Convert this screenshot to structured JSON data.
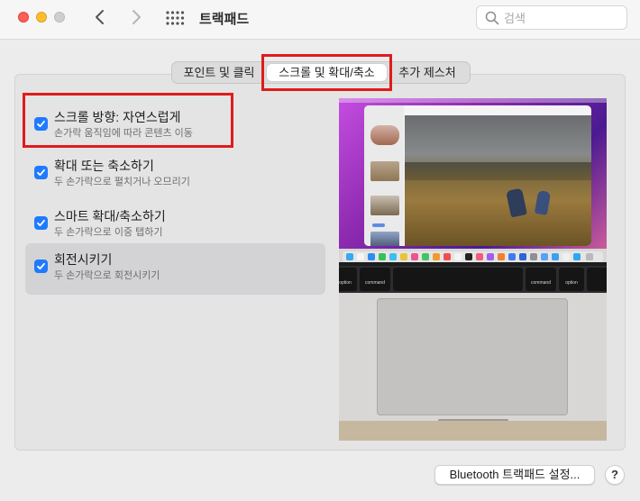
{
  "window": {
    "title": "트랙패드",
    "search_placeholder": "검색"
  },
  "tabs": [
    {
      "label": "포인트 및 클릭",
      "selected": false
    },
    {
      "label": "스크롤 및 확대/축소",
      "selected": true
    },
    {
      "label": "추가 제스처",
      "selected": false
    }
  ],
  "options": [
    {
      "title": "스크롤 방향: 자연스럽게",
      "subtitle": "손가락 움직임에 따라 콘텐츠 이동",
      "checked": true
    },
    {
      "title": "확대 또는 축소하기",
      "subtitle": "두 손가락으로 펼치거나 오므리기",
      "checked": true
    },
    {
      "title": "스마트 확대/축소하기",
      "subtitle": "두 손가락으로 이중 탭하기",
      "checked": true
    },
    {
      "title": "회전시키기",
      "subtitle": "두 손가락으로 회전시키기",
      "checked": true,
      "selected": true
    }
  ],
  "preview": {
    "keys": {
      "left1": "option",
      "left2": "command",
      "right1": "command",
      "right2": "option"
    }
  },
  "footer": {
    "bluetooth_button": "Bluetooth 트랙패드 설정...",
    "help_button": "?"
  },
  "colors": {
    "accent": "#1f7aff",
    "annotation": "#e01b1b"
  }
}
